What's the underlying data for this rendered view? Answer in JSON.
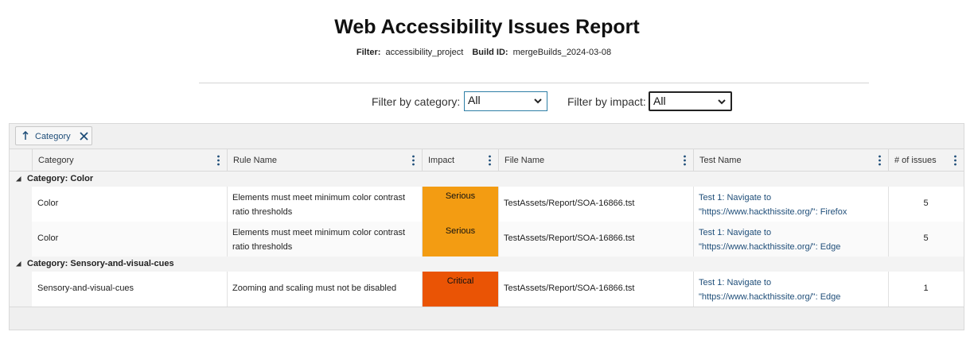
{
  "report": {
    "title": "Web Accessibility Issues Report",
    "filter_label": "Filter:",
    "filter_value": "accessibility_project",
    "build_label": "Build ID:",
    "build_value": "mergeBuilds_2024-03-08"
  },
  "filters": {
    "category_label": "Filter by category:",
    "category_value": "All",
    "impact_label": "Filter by impact:",
    "impact_value": "All"
  },
  "grouping": {
    "chip_label": "Category",
    "icons": {
      "sort": "arrow-up-icon",
      "remove": "close-icon"
    }
  },
  "columns": [
    "Category",
    "Rule Name",
    "Impact",
    "File Name",
    "Test Name",
    "# of issues"
  ],
  "groups": [
    {
      "label": "Category: Color"
    },
    {
      "label": "Category: Sensory-and-visual-cues"
    }
  ],
  "rows": [
    {
      "category": "Color",
      "rule": "Elements must meet minimum color contrast ratio thresholds",
      "impact": "Serious",
      "file": "TestAssets/Report/SOA-16866.tst",
      "test_line1": "Test 1: Navigate to",
      "test_line2": "\"https://www.hackthissite.org/\": Firefox",
      "issues": "5"
    },
    {
      "category": "Color",
      "rule": "Elements must meet minimum color contrast ratio thresholds",
      "impact": "Serious",
      "file": "TestAssets/Report/SOA-16866.tst",
      "test_line1": "Test 1: Navigate to",
      "test_line2": "\"https://www.hackthissite.org/\": Edge",
      "issues": "5"
    },
    {
      "category": "Sensory-and-visual-cues",
      "rule": "Zooming and scaling must not be disabled",
      "impact": "Critical",
      "file": "TestAssets/Report/SOA-16866.tst",
      "test_line1": "Test 1: Navigate to",
      "test_line2": "\"https://www.hackthissite.org/\": Edge",
      "issues": "1"
    }
  ],
  "colors": {
    "serious": "#f39c12",
    "critical": "#ea5405",
    "link": "#1f4e79"
  }
}
